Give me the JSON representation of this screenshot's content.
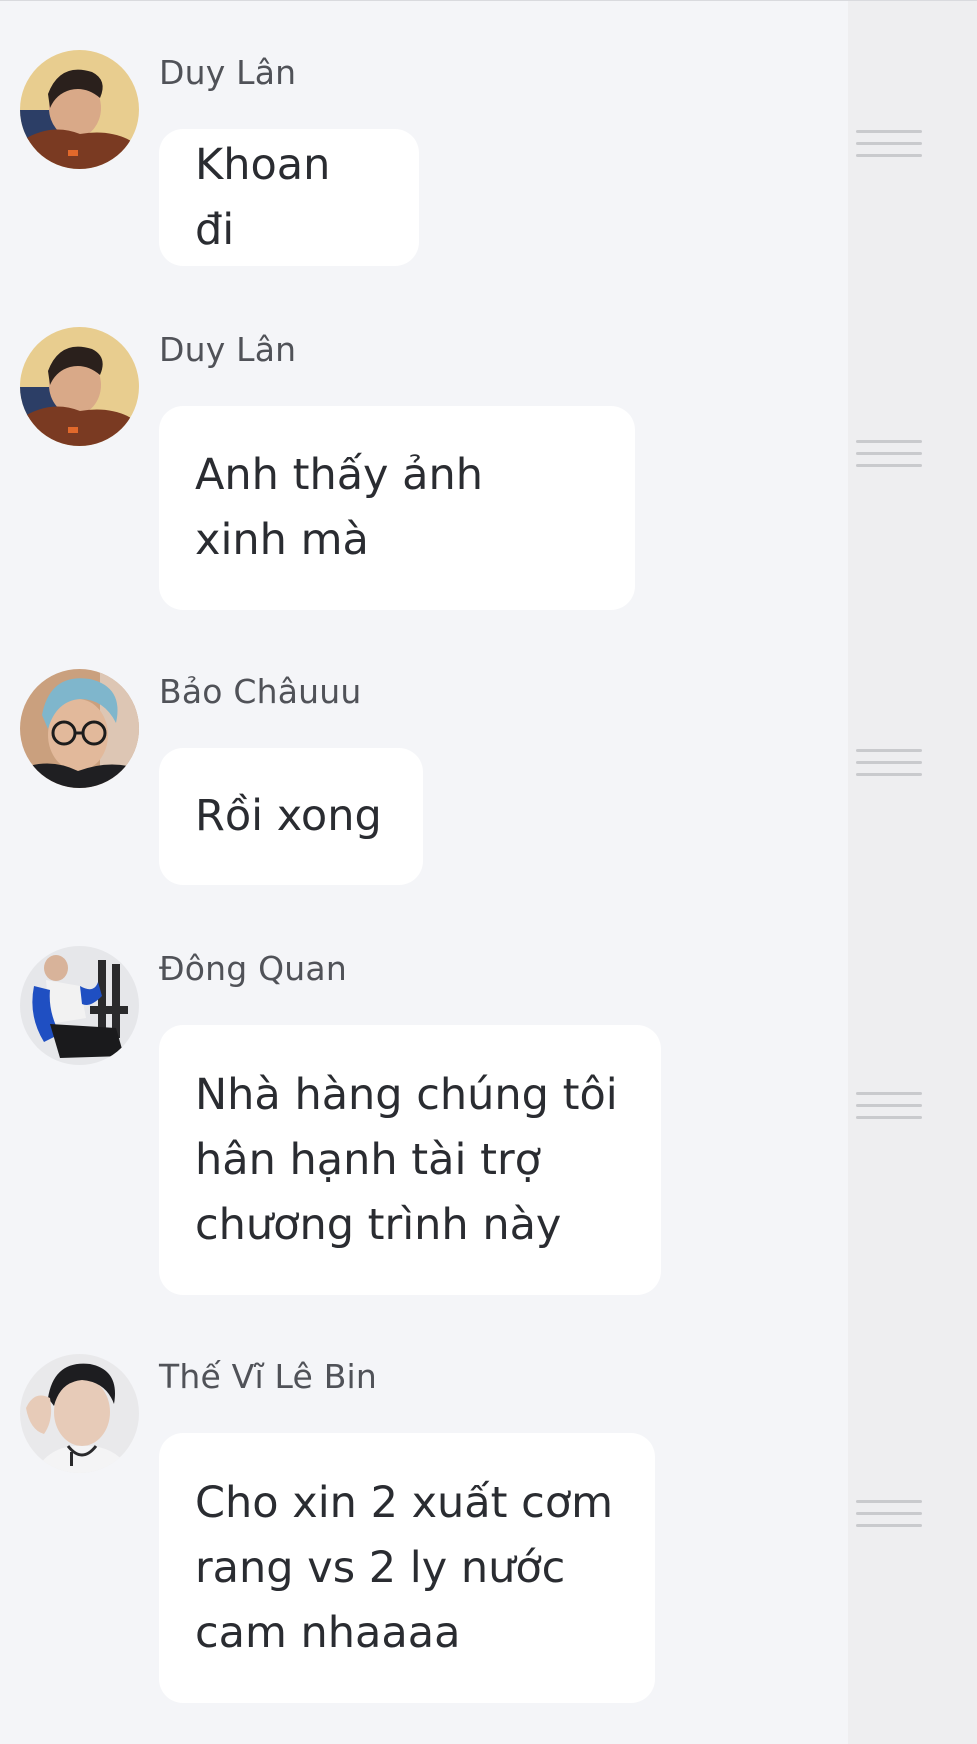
{
  "messages": [
    {
      "sender": "Duy Lân",
      "text": "Khoan đi",
      "avatar_icon": "person-sleeping-avatar"
    },
    {
      "sender": "Duy Lân",
      "text": "Anh thấy ảnh\nxinh mà",
      "avatar_icon": "person-sleeping-avatar"
    },
    {
      "sender": "Bảo Châuuu",
      "text": "Rồi xong",
      "avatar_icon": "person-blue-hair-glasses-avatar"
    },
    {
      "sender": "Đông Quan",
      "text": "Nhà hàng chúng tôi\nhân hạnh tài trợ\nchương trình này",
      "avatar_icon": "person-blue-jacket-chair-avatar"
    },
    {
      "sender": "Thế Vĩ Lê Bin",
      "text": "Cho xin 2 xuất cơm\nrang vs 2 ly nước\ncam nhaaaa",
      "avatar_icon": "person-portrait-avatar"
    }
  ],
  "colors": {
    "background": "#f4f5f8",
    "bubble": "#ffffff",
    "sender_text": "#505258",
    "message_text": "#2a2c31",
    "handle": "#c9cacd"
  }
}
